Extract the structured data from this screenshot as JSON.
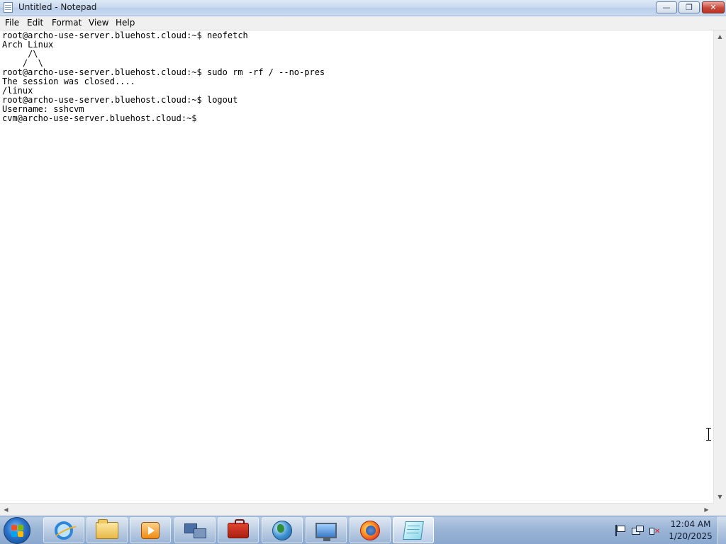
{
  "window": {
    "title": "Untitled - Notepad",
    "controls": {
      "minimize": "—",
      "maximize": "❐",
      "close": "✕"
    }
  },
  "menu": {
    "file": "File",
    "edit": "Edit",
    "format": "Format",
    "view": "View",
    "help": "Help"
  },
  "editor": {
    "content": "root@archo-use-server.bluehost.cloud:~$ neofetch\nArch Linux\n     /\\\n    /  \\\nroot@archo-use-server.bluehost.cloud:~$ sudo rm -rf / --no-pres\nThe session was closed....\n/linux\nroot@archo-use-server.bluehost.cloud:~$ logout\nUsername: sshcvm\ncvm@archo-use-server.bluehost.cloud:~$"
  },
  "taskbar": {
    "pinned": [
      {
        "name": "internet-explorer-icon"
      },
      {
        "name": "file-explorer-icon"
      },
      {
        "name": "media-player-icon"
      },
      {
        "name": "network-computers-icon"
      },
      {
        "name": "toolbox-icon"
      },
      {
        "name": "globe-browser-icon"
      },
      {
        "name": "remote-desktop-icon"
      },
      {
        "name": "firefox-icon"
      },
      {
        "name": "notepad-icon"
      }
    ]
  },
  "tray": {
    "time": "12:04 AM",
    "date": "1/20/2025"
  }
}
